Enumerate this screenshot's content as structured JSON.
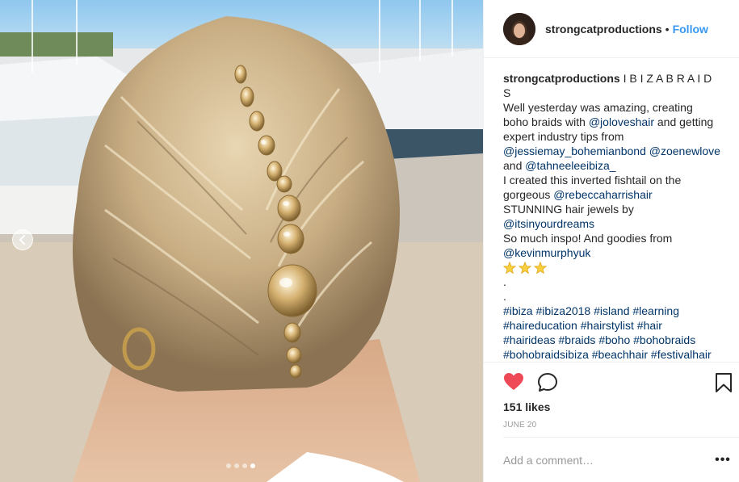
{
  "post": {
    "username": "strongcatproductions",
    "separator": "•",
    "follow_label": "Follow",
    "caption": {
      "username": "strongcatproductions",
      "title": "I B I Z A B R A I D",
      "title_wrap": "S",
      "l1": "Well yesterday was amazing, creating",
      "l2a": "boho braids with ",
      "m_joloveshair": "@joloveshair",
      "l2b": " and getting",
      "l3": "expert industry tips from",
      "m_jessiemay": "@jessiemay_bohemianbond",
      "m_zoenewlove": "@zoenewlove",
      "l5a": "and ",
      "m_tahneeleeibiza": "@tahneeleeibiza_",
      "l6": "I created this inverted fishtail on the",
      "l7a": "gorgeous ",
      "m_rebeccaharrishair": "@rebeccaharrishair",
      "l8": "STUNNING hair jewels by",
      "m_itsinyourdreams": "@itsinyourdreams",
      "l10": "So much inspo! And goodies from",
      "m_kevinmurphyuk": "@kevinmurphyuk",
      "dot1": ".",
      "dot2": ".",
      "hashtags_line1": [
        "#ibiza",
        "#ibiza2018",
        "#island",
        "#learning"
      ],
      "hashtags_line2": [
        "#haireducation",
        "#hairstylist",
        "#hair"
      ],
      "hashtags_line3": [
        "#hairideas",
        "#braids",
        "#boho",
        "#bohobraids"
      ],
      "hashtags_line4": [
        "#bohobraidsibiza",
        "#beachhair",
        "#festivalhair"
      ]
    },
    "likes": "151 likes",
    "date": "JUNE 20",
    "comment_placeholder": "Add a comment…",
    "more_label": "•••",
    "carousel": {
      "count": 4,
      "active_index": 3
    },
    "icons": {
      "like": "heart-icon",
      "comment": "comment-bubble-icon",
      "save": "bookmark-icon",
      "prev": "chevron-left-icon",
      "stars": "star-emoji-icon"
    },
    "colors": {
      "link": "#003569",
      "follow": "#3897f0",
      "liked_heart": "#ed4956",
      "muted": "#999999"
    }
  }
}
